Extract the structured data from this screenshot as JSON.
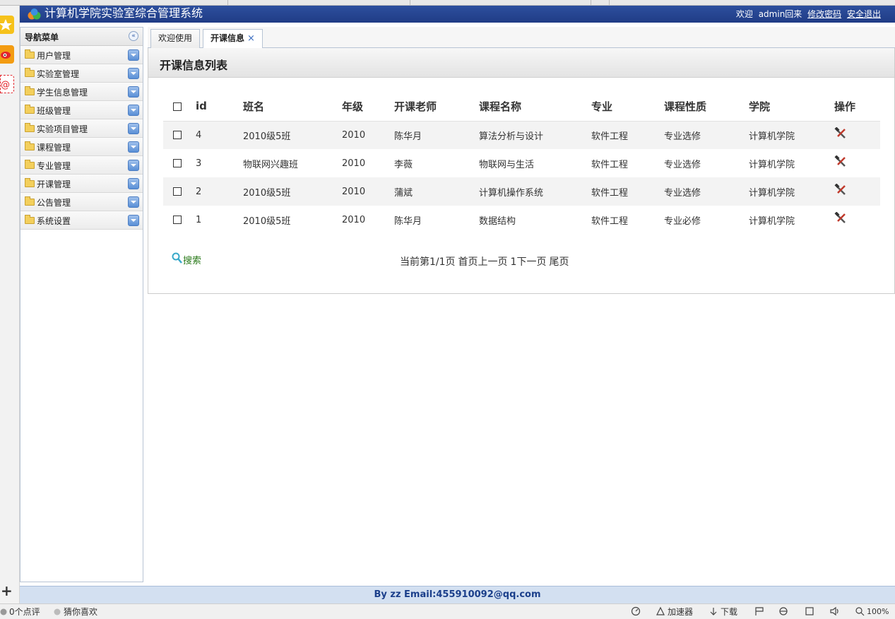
{
  "app": {
    "title": "计算机学院实验室综合管理系统",
    "welcome": "欢迎",
    "user": "admin回来",
    "change_password": "修改密码",
    "logout": "安全退出"
  },
  "sidebar": {
    "title": "导航菜单",
    "items": [
      {
        "label": "用户管理"
      },
      {
        "label": "实验室管理"
      },
      {
        "label": "学生信息管理"
      },
      {
        "label": "班级管理"
      },
      {
        "label": "实验项目管理"
      },
      {
        "label": "课程管理"
      },
      {
        "label": "专业管理"
      },
      {
        "label": "开课管理"
      },
      {
        "label": "公告管理"
      },
      {
        "label": "系统设置"
      }
    ]
  },
  "tabs": [
    {
      "label": "欢迎使用"
    },
    {
      "label": "开课信息",
      "close": "×"
    }
  ],
  "panel": {
    "title": "开课信息列表"
  },
  "table": {
    "headers": [
      "id",
      "班名",
      "年级",
      "开课老师",
      "课程名称",
      "专业",
      "课程性质",
      "学院",
      "操作"
    ],
    "rows": [
      {
        "id": "4",
        "class": "2010级5班",
        "grade": "2010",
        "teacher": "陈华月",
        "course": "算法分析与设计",
        "major": "软件工程",
        "nature": "专业选修",
        "college": "计算机学院"
      },
      {
        "id": "3",
        "class": "物联网兴趣班",
        "grade": "2010",
        "teacher": "李薇",
        "course": "物联网与生活",
        "major": "软件工程",
        "nature": "专业选修",
        "college": "计算机学院"
      },
      {
        "id": "2",
        "class": "2010级5班",
        "grade": "2010",
        "teacher": "蒲斌",
        "course": "计算机操作系统",
        "major": "软件工程",
        "nature": "专业选修",
        "college": "计算机学院"
      },
      {
        "id": "1",
        "class": "2010级5班",
        "grade": "2010",
        "teacher": "陈华月",
        "course": "数据结构",
        "major": "软件工程",
        "nature": "专业必修",
        "college": "计算机学院"
      }
    ]
  },
  "search": {
    "label": "搜索"
  },
  "pager": {
    "info": "当前第1/1页",
    "first": "首页",
    "prev": "上一页",
    "current": "1",
    "next": "下一页",
    "last": "尾页"
  },
  "footer": {
    "text": "By zz Email:455910092@qq.com"
  },
  "statusbar": {
    "comments": "0个点评",
    "recommend": "猜你喜欢",
    "accelerator": "加速器",
    "download": "下载",
    "zoom": "100%"
  },
  "colors": {
    "header": "#203c86",
    "footer": "#d3e0f1",
    "footer_text": "#1b3f8b",
    "search_link": "#2a7a1a",
    "tab_close": "#3a6cc0"
  }
}
